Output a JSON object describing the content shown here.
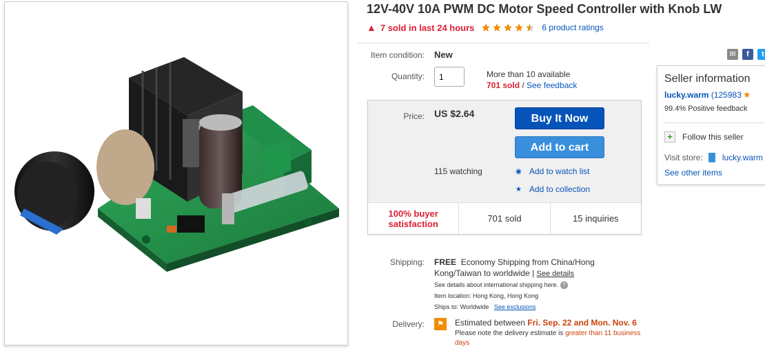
{
  "product": {
    "title": "12V-40V 10A PWM DC Motor Speed Controller with Knob LW",
    "sold_recent": "7 sold in last 24 hours",
    "rating_value": 4.5,
    "rating_max": 5,
    "ratings_link": "6 product ratings"
  },
  "condition": {
    "label": "Item condition:",
    "value": "New"
  },
  "quantity": {
    "label": "Quantity:",
    "value": "1",
    "available": "More than 10 available",
    "sold": "701 sold",
    "separator": " / ",
    "feedback_link": "See feedback"
  },
  "price": {
    "label": "Price:",
    "value": "US $2.64",
    "buy_now": "Buy It Now",
    "add_to_cart": "Add to cart",
    "watching": "115 watching",
    "watch_list": "Add to watch list",
    "collection": "Add to collection"
  },
  "stats": {
    "satisfaction": "100% buyer satisfaction",
    "sold": "701 sold",
    "inquiries": "15 inquiries"
  },
  "shipping": {
    "label": "Shipping:",
    "free": "FREE",
    "text": "Economy Shipping from China/Hong Kong/Taiwan to worldwide |",
    "details_link": "See details",
    "intl_note": "See details about international shipping here.",
    "location": "Item location:  Hong Kong, Hong Kong",
    "ships_to_label": "Ships to:  Worldwide",
    "exclusions_link": "See exclusions"
  },
  "delivery": {
    "label": "Delivery:",
    "estimated": "Estimated between",
    "dates": "Fri. Sep. 22 and Mon. Nov. 6",
    "note": "Please note the delivery estimate is",
    "note_highlight": "greater than 11 business days"
  },
  "seller": {
    "title": "Seller information",
    "name": "lucky.warm",
    "score": "(125983",
    "feedback": "99.4% Positive feedback",
    "follow": "Follow this seller",
    "visit_store": "Visit store:",
    "store_name": "lucky.warm",
    "other_items": "See other items"
  },
  "colors": {
    "link": "#0654ba",
    "buy": "#0654ba",
    "cart": "#3a8fdc",
    "alert_red": "#dd1e31",
    "orange": "#c9420c",
    "star": "#f18d00"
  }
}
